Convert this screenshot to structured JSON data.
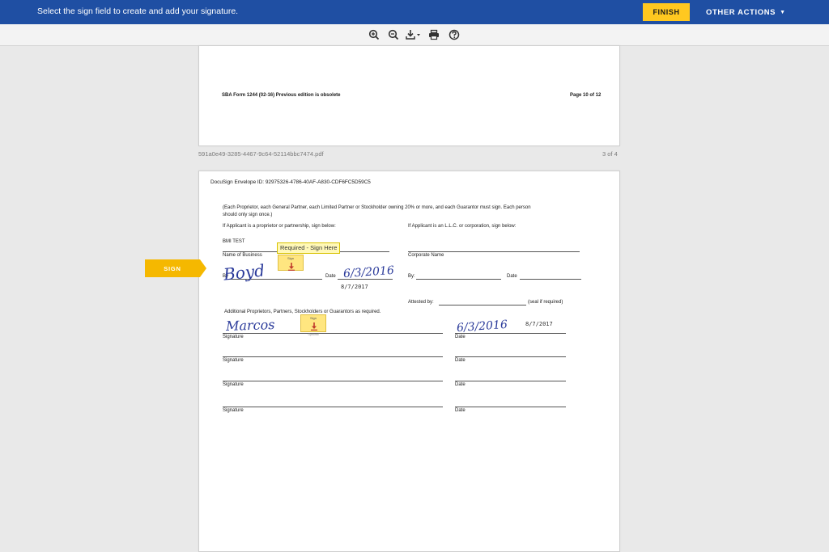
{
  "topbar": {
    "message": "Select the sign field to create and add your signature.",
    "finish_label": "FINISH",
    "other_actions_label": "OTHER ACTIONS",
    "caret": "▼"
  },
  "toolbar": {
    "icons": [
      "zoom-in-icon",
      "zoom-out-icon",
      "download-icon",
      "print-icon",
      "help-icon"
    ]
  },
  "page1": {
    "footer_left": "SBA Form 1244 (02-16) Previous edition is obsolete",
    "footer_right": "Page 10 of 12"
  },
  "document": {
    "filename": "591a0e49-3285-4467-9c64-52114bbc7474.pdf",
    "page_count": "3 of 4"
  },
  "page2": {
    "envelope_id": "DocuSign Envelope ID: 92975326-4786-40AF-A830-CDF6FC5D59C5",
    "instruction_line1": "(Each Proprietor, each General Partner, each Limited Partner or Stockholder owning 20% or more, and each Guarantor must sign. Each person",
    "instruction_line2": "should only sign once.)",
    "left_heading": "If Applicant is a proprietor or partnership, sign below:",
    "right_heading": "If Applicant is an L.L.C. or corporation, sign below:",
    "business_value": "BMI TEST",
    "name_of_business": "Name of Business",
    "corporate_name": "Corporate Name",
    "by_label": "By",
    "date_label": "Date",
    "by_right": "By:",
    "date_right": "Date",
    "attested_by": "Attested by:",
    "seal": "(seal if required)",
    "additional": "Additional Proprietors, Partners, Stockholders or Guarantors as required.",
    "signature_label": "Signature",
    "date_col_label": "Date",
    "signature_boyd": "Boyd",
    "handwritten_date1": "6/3/2016",
    "stamped_date1": "8/7/2017",
    "signature_marcos": "Marcos",
    "handwritten_date2": "6/3/2016",
    "stamped_date2": "8/7/2017"
  },
  "sign_tab_label": "SIGN",
  "tooltip": "Required - Sign Here",
  "sign_field": {
    "label": "Sign",
    "sub": "Optional"
  },
  "colors": {
    "topbar": "#1f4fa3",
    "finish": "#ffc820",
    "sign_tab": "#f5b800",
    "sign_field": "#ffe680",
    "ink": "#2a3a9a"
  }
}
